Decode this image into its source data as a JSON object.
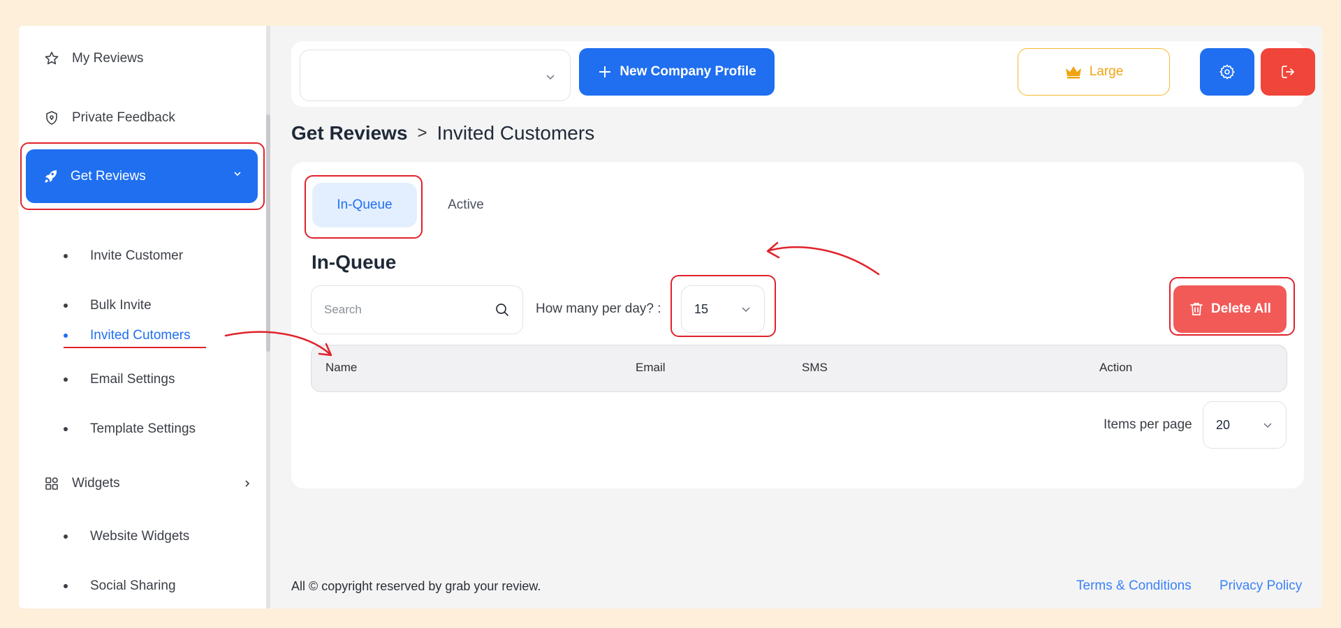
{
  "sidebar": {
    "my_reviews": "My Reviews",
    "private_feedback": "Private Feedback",
    "get_reviews": "Get Reviews",
    "sub_items": [
      "Invite Customer",
      "Bulk Invite",
      "Invited Cutomers",
      "Email Settings",
      "Template Settings"
    ],
    "widgets": "Widgets",
    "widget_items": [
      "Website Widgets",
      "Social Sharing"
    ]
  },
  "topbar": {
    "company_select_value": "",
    "new_company_label": "New Company Profile",
    "plan_label": "Large",
    "plan_icon": "crown-icon",
    "settings_icon": "gear-icon",
    "logout_icon": "logout-icon"
  },
  "breadcrumb": {
    "parent": "Get Reviews",
    "separator": ">",
    "current": "Invited Customers"
  },
  "tabs": [
    "In-Queue",
    "Active"
  ],
  "section_title": "In-Queue",
  "search": {
    "placeholder": "Search"
  },
  "per_day": {
    "label": "How many per day? :",
    "value": "15"
  },
  "delete_all_label": "Delete All",
  "table": {
    "columns": [
      "Name",
      "Email",
      "SMS",
      "Action"
    ],
    "rows": []
  },
  "pagination": {
    "label": "Items per page",
    "value": "20"
  },
  "footer": {
    "copyright": "All © copyright reserved by grab your review.",
    "terms": "Terms & Conditions",
    "privacy": "Privacy Policy"
  },
  "colors": {
    "primary": "#1f6ff0",
    "danger": "#f25a57",
    "annotation": "#e0222b",
    "plan_gold": "#f0a413",
    "background": "#fdefd9"
  }
}
